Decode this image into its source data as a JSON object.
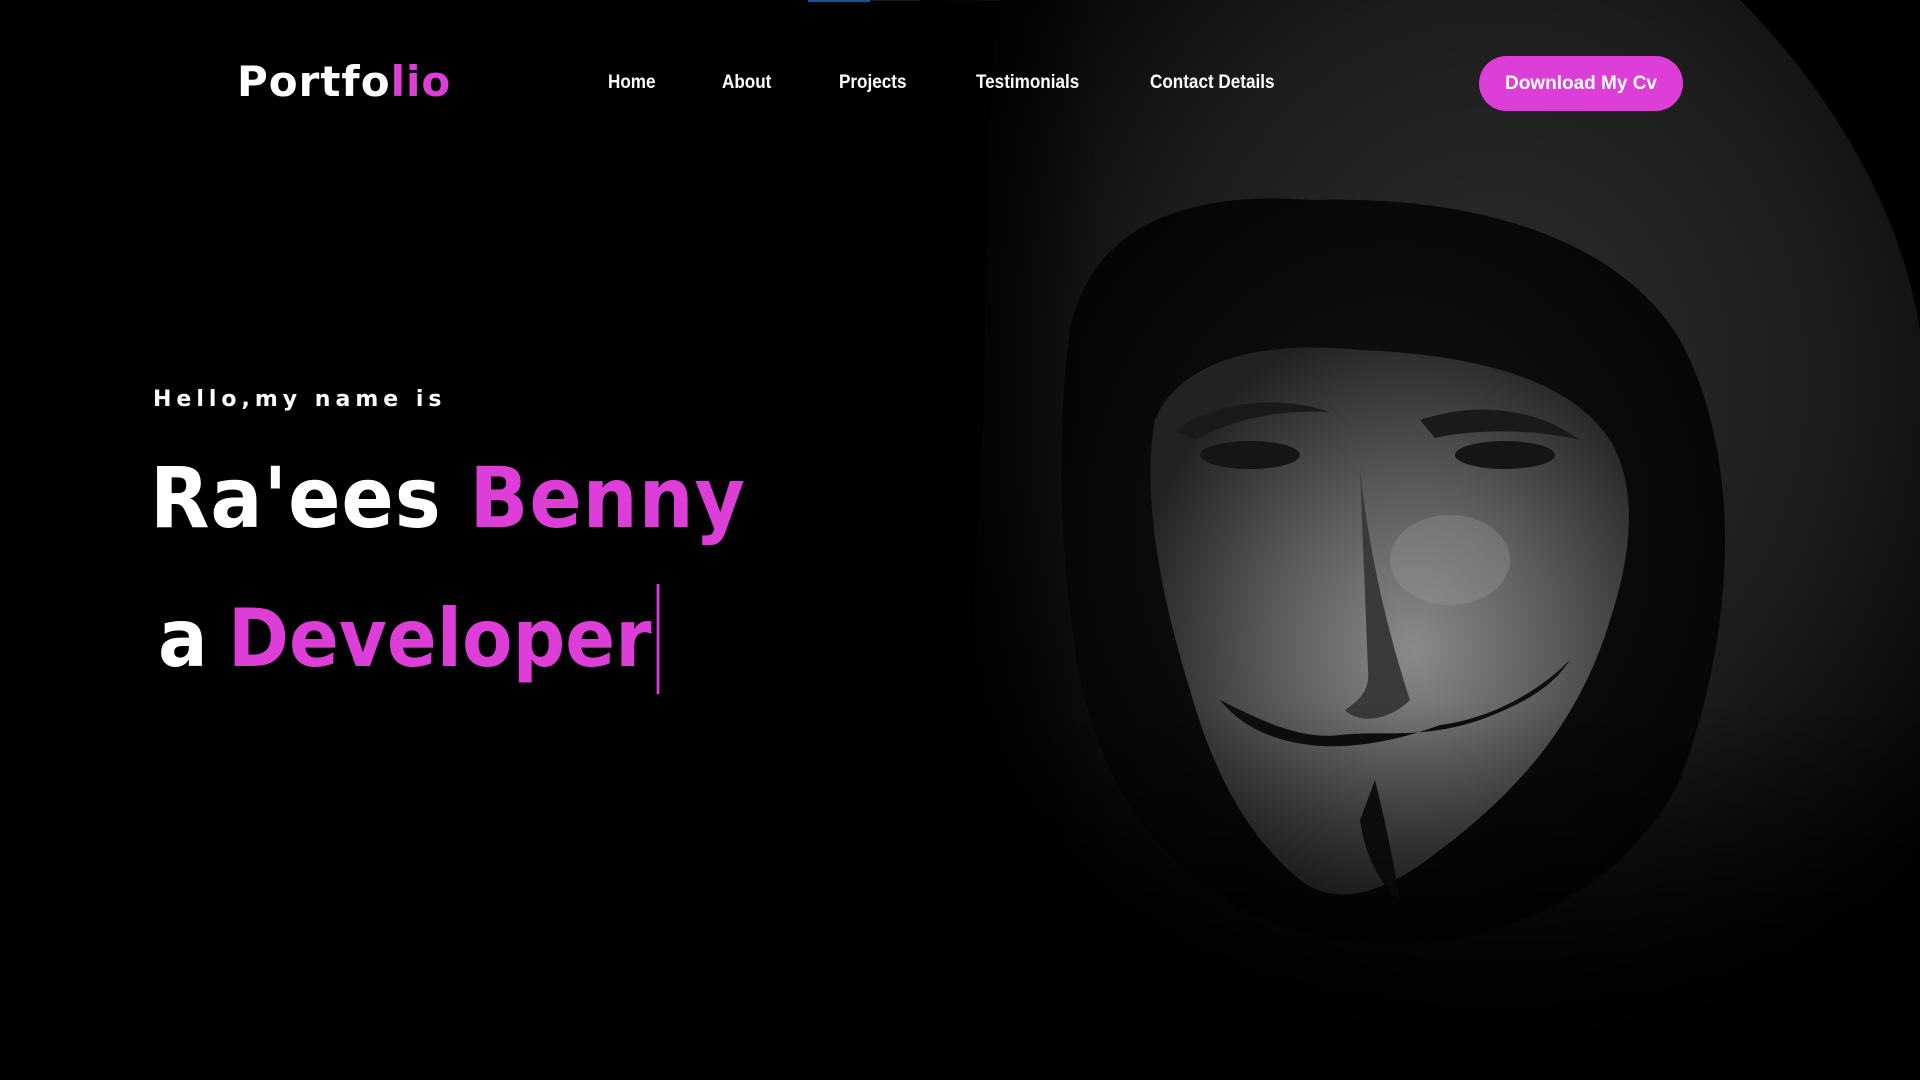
{
  "brand": {
    "logo_main": "Portfo",
    "logo_accent": "lio",
    "accent_color": "#dd3ed8"
  },
  "nav": {
    "items": [
      {
        "label": "Home"
      },
      {
        "label": "About"
      },
      {
        "label": "Projects"
      },
      {
        "label": "Testimonials"
      },
      {
        "label": "Contact Details"
      }
    ],
    "cta_label": "Download My Cv"
  },
  "hero": {
    "greeting": "Hello,my name is",
    "first_name": "Ra'ees",
    "last_name": "Benny",
    "role_prefix": "a",
    "role_word": "Developer",
    "image_icon": "hooded-mask-figure"
  }
}
